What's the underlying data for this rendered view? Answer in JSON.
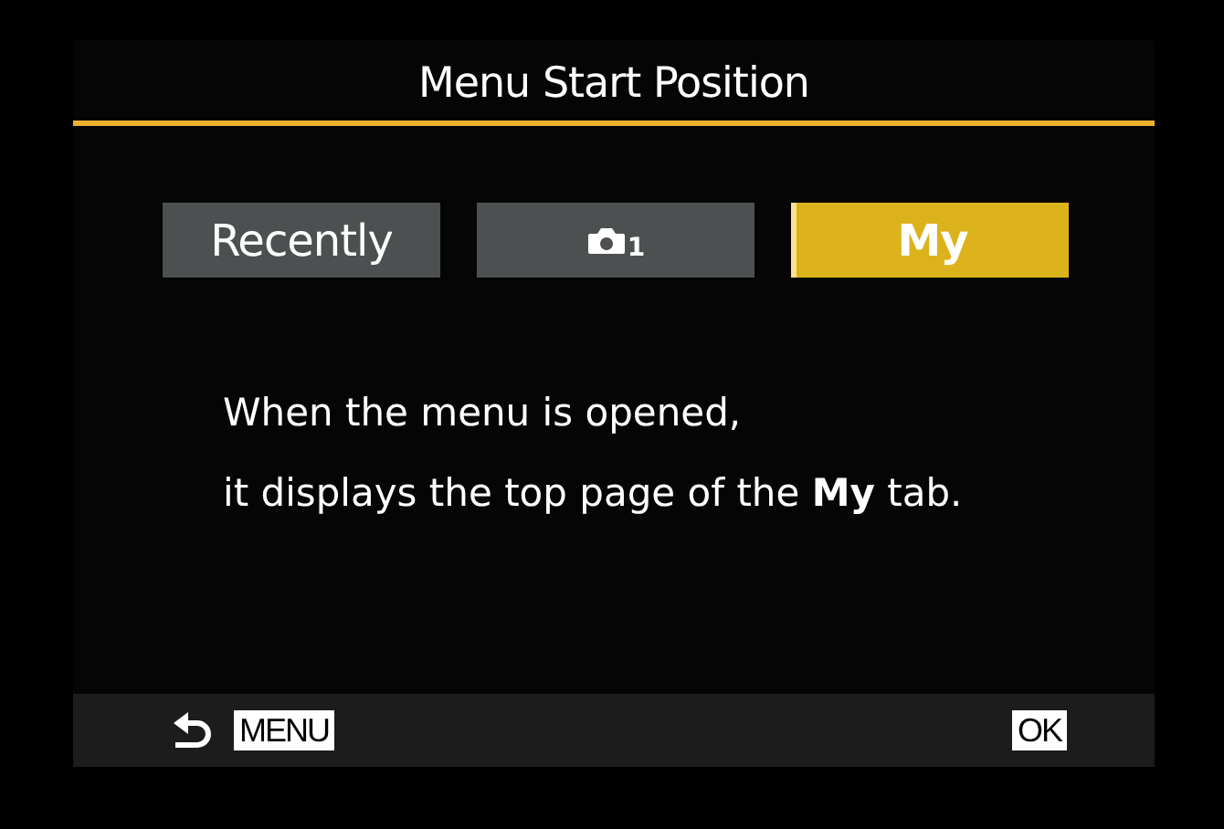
{
  "title": "Menu Start Position",
  "options": [
    {
      "kind": "text",
      "label": "Recently",
      "selected": false
    },
    {
      "kind": "camera",
      "label": "1",
      "selected": false
    },
    {
      "kind": "text",
      "label": "My",
      "selected": true
    }
  ],
  "description": [
    "When the menu is opened,",
    "it displays the top page of the **My** tab."
  ],
  "footer": {
    "back_key": "MENU",
    "ok_key": "OK"
  }
}
